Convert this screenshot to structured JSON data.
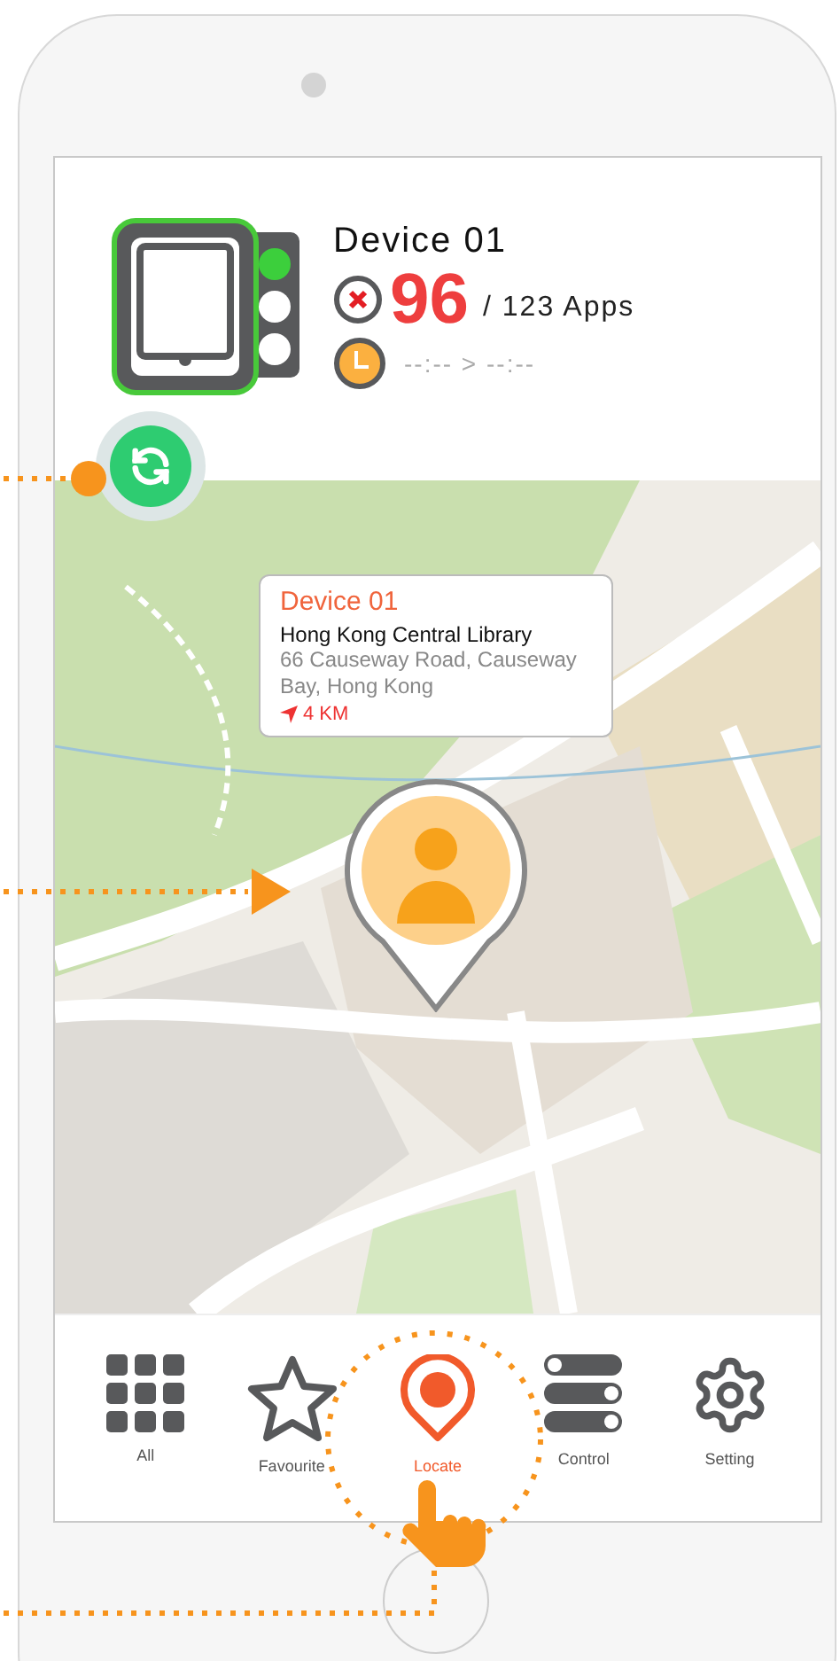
{
  "device": {
    "name": "Device 01",
    "blocked": "96",
    "total": "/ 123 Apps",
    "schedule": "--:-- > --:--",
    "lights": [
      {
        "on": true
      },
      {
        "on": false
      },
      {
        "on": false
      }
    ]
  },
  "callout": {
    "title": "Device 01",
    "place": "Hong Kong Central Library",
    "address": "66 Causeway Road, Causeway Bay, Hong Kong",
    "distance": "4 KM"
  },
  "tabs": [
    {
      "label": "All",
      "kind": "grid",
      "selected": false
    },
    {
      "label": "Favourite",
      "kind": "star",
      "selected": false
    },
    {
      "label": "Locate",
      "kind": "pin",
      "selected": true
    },
    {
      "label": "Control",
      "kind": "toggles",
      "selected": false
    },
    {
      "label": "Setting",
      "kind": "gear",
      "selected": false
    }
  ]
}
